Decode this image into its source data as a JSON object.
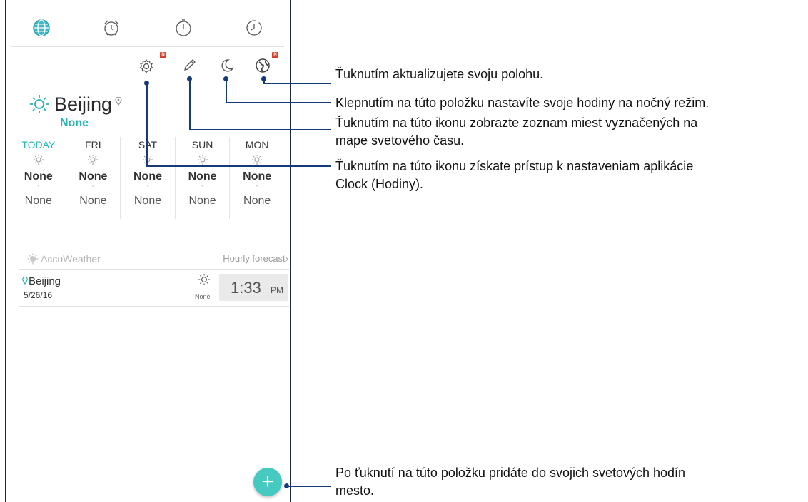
{
  "tabs": [
    {
      "name": "world-clock",
      "icon": "globe-icon",
      "active": true
    },
    {
      "name": "alarm",
      "icon": "alarm-clock-icon",
      "active": false
    },
    {
      "name": "stopwatch",
      "icon": "stopwatch-icon",
      "active": false
    },
    {
      "name": "timer",
      "icon": "timer-icon",
      "active": false
    }
  ],
  "toolbar": {
    "settings_badge": "N",
    "location_badge": "N"
  },
  "weather": {
    "city": "Beijing",
    "status": "None",
    "forecast": [
      {
        "day": "TODAY",
        "high": "None",
        "low": "None",
        "today": true
      },
      {
        "day": "FRI",
        "high": "None",
        "low": "None"
      },
      {
        "day": "SAT",
        "high": "None",
        "low": "None"
      },
      {
        "day": "SUN",
        "high": "None",
        "low": "None"
      },
      {
        "day": "MON",
        "high": "None",
        "low": "None"
      }
    ],
    "provider": "AccuWeather",
    "hourly_link": "Hourly forecast",
    "hourly_chevron": "›"
  },
  "clock_item": {
    "city": "Beijing",
    "date": "5/26/16",
    "condition": "None",
    "time": "1:33",
    "ampm": "PM"
  },
  "fab": {
    "label": "+"
  },
  "callouts": {
    "location": "Ťuknutím aktualizujete svoju polohu.",
    "night_mode": "Klepnutím na túto položku nastavíte svoje hodiny na nočný režim.",
    "edit_line1": "Ťuknutím na túto ikonu zobrazte zoznam miest vyznačených na",
    "edit_line2": "mape svetového času.",
    "settings_line1": "Ťuknutím na túto ikonu získate prístup k nastaveniam aplikácie",
    "settings_line2": "Clock (Hodiny).",
    "add_line1": "Po ťuknutí na túto položku pridáte do svojich svetových hodín",
    "add_line2": "mesto."
  },
  "colors": {
    "accent": "#26b5b5",
    "fab": "#45c9c0",
    "callout_line": "#143a7a",
    "badge": "#d9412e"
  }
}
